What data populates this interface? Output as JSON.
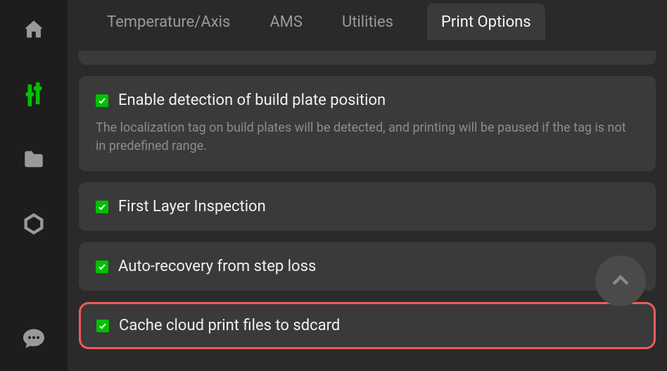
{
  "sidebar": {
    "items": [
      {
        "name": "home-icon"
      },
      {
        "name": "sliders-icon"
      },
      {
        "name": "folder-icon"
      },
      {
        "name": "hex-icon"
      },
      {
        "name": "chat-icon"
      }
    ]
  },
  "tabs": [
    {
      "label": "Temperature/Axis",
      "active": false
    },
    {
      "label": "AMS",
      "active": false
    },
    {
      "label": "Utilities",
      "active": false
    },
    {
      "label": "Print Options",
      "active": true
    }
  ],
  "options": [
    {
      "title": "Enable detection of build plate position",
      "desc": "The localization tag on build plates will be detected, and printing will be paused if the tag is not in predefined range.",
      "checked": true,
      "highlighted": false
    },
    {
      "title": "First Layer Inspection",
      "desc": "",
      "checked": true,
      "highlighted": false
    },
    {
      "title": "Auto-recovery from step loss",
      "desc": "",
      "checked": true,
      "highlighted": false
    },
    {
      "title": "Cache cloud print files to sdcard",
      "desc": "",
      "checked": true,
      "highlighted": true
    }
  ],
  "colors": {
    "accent": "#00c000",
    "highlight": "#f05a5a",
    "sidebar_active": "#00c000"
  }
}
